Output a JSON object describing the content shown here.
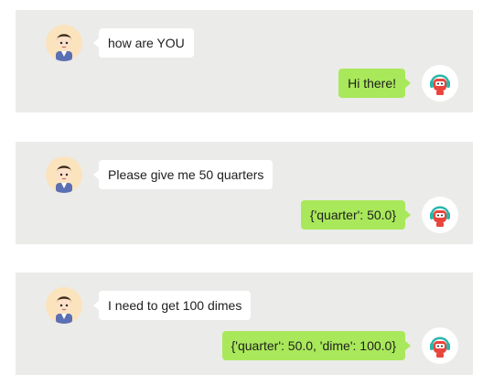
{
  "colors": {
    "panel_bg": "#ebebe9",
    "user_bubble": "#ffffff",
    "bot_bubble": "#a9e85a",
    "user_avatar_bg": "#fbe3be"
  },
  "icons": {
    "user_avatar": "boy-cartoon-avatar-icon",
    "bot_avatar": "robot-headphones-avatar-icon"
  },
  "conversation": [
    {
      "user": "how are YOU",
      "bot": "Hi there!"
    },
    {
      "user": "Please give me 50 quarters",
      "bot": "{'quarter': 50.0}"
    },
    {
      "user": "I need to get 100 dimes",
      "bot": "{'quarter': 50.0, 'dime': 100.0}"
    }
  ]
}
